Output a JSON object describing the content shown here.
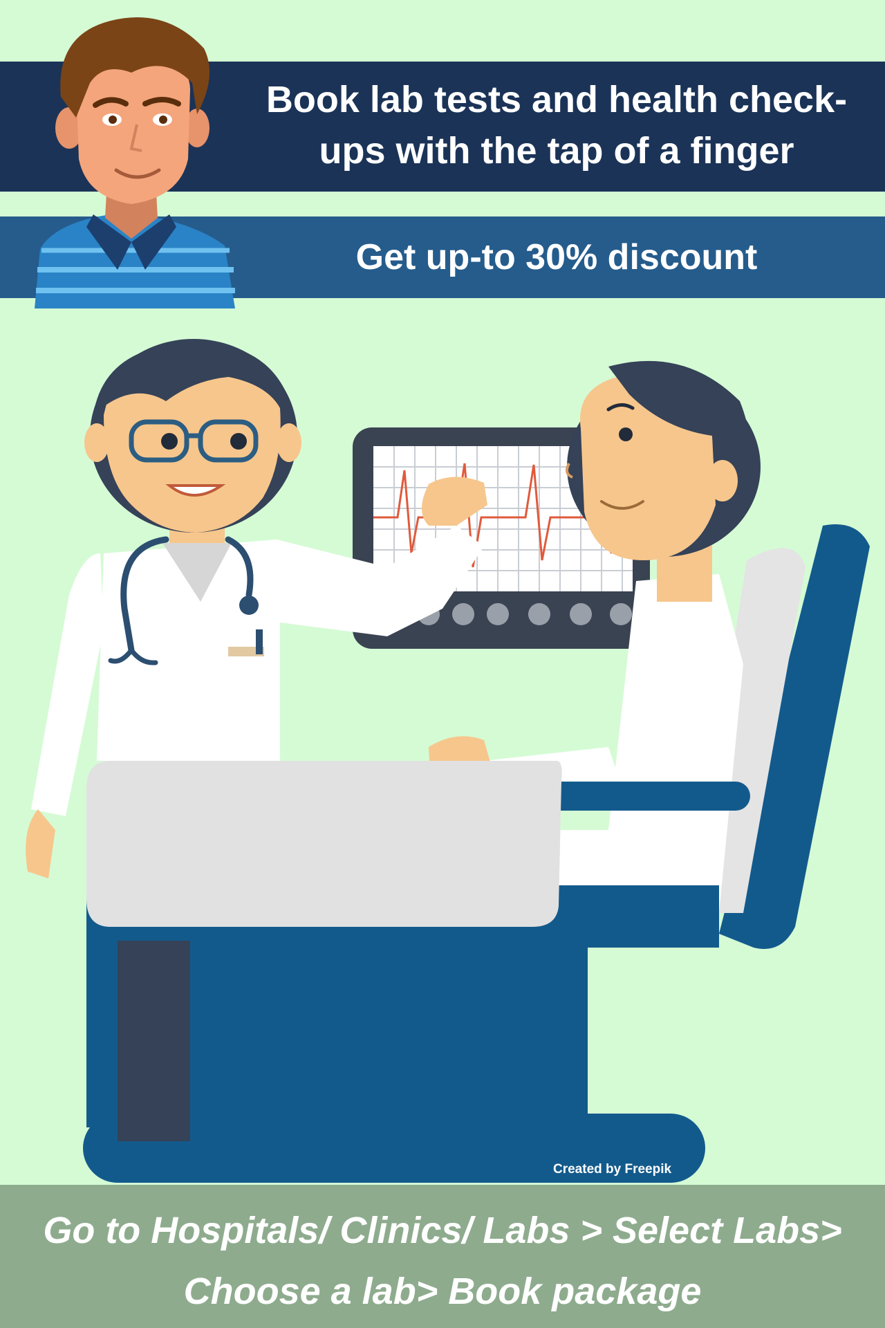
{
  "promo": {
    "headline": "Book lab tests and health check-ups with the tap of a finger",
    "discount": "Get up-to 30% discount",
    "credit": "Created by Freepik",
    "instructions_line1": "Go to Hospitals/ Clinics/ Labs > Select Labs>",
    "instructions_line2": "Choose a lab> Book package"
  },
  "colors": {
    "background": "#d5fbd5",
    "banner_dark": "#1b3357",
    "banner_mid": "#255c8c",
    "footer": "#8eab8e",
    "chair_blue": "#135a8c"
  },
  "icons": [
    "avatar-man",
    "doctor",
    "patient",
    "heart-monitor",
    "stethoscope",
    "examination-chair"
  ]
}
